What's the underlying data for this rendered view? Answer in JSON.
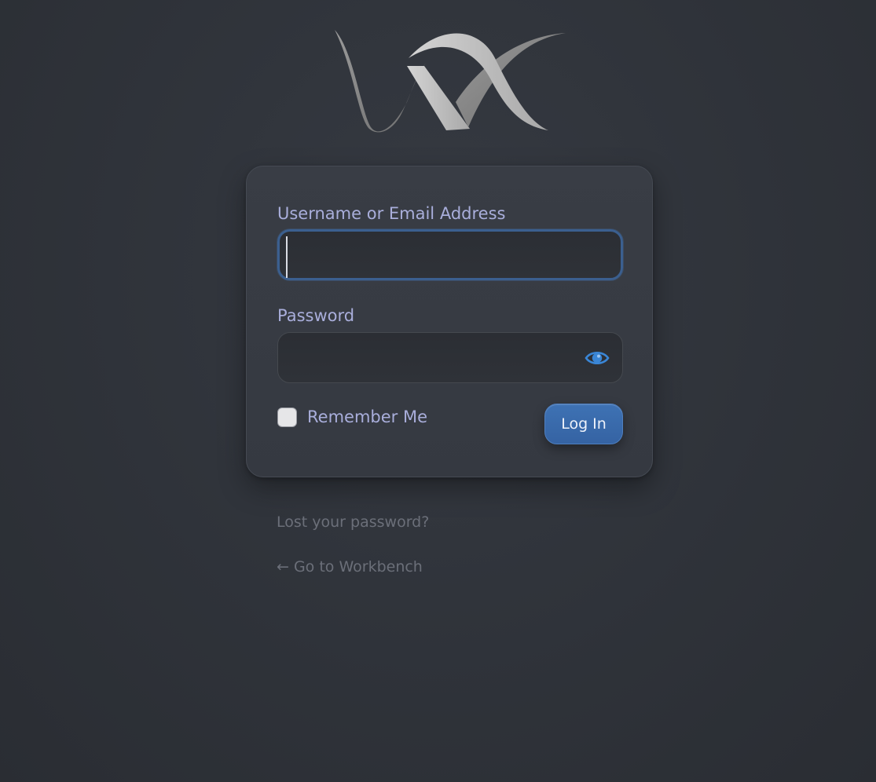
{
  "brand": {
    "logo_icon": "vx-swoosh-logo"
  },
  "login_form": {
    "username_label": "Username or Email Address",
    "username_value": "",
    "password_label": "Password",
    "password_value": "",
    "password_toggle_icon": "eye-icon",
    "remember_label": "Remember Me",
    "remember_checked": false,
    "submit_label": "Log In"
  },
  "links": {
    "lost_password": "Lost your password?",
    "back_to_site": "← Go to Workbench"
  },
  "colors": {
    "accent": "#3e72b4",
    "label": "#a9aedb",
    "focus_ring": "#3b5f8f",
    "link": "#6b6f79",
    "eye_icon": "#3a86d6"
  }
}
